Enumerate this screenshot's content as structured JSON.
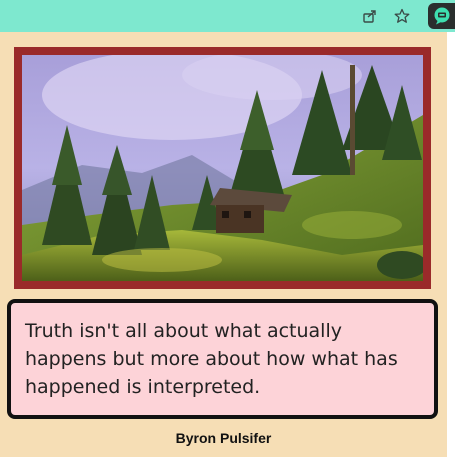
{
  "quote": {
    "text": "Truth isn't all about what actually happens but more about how what has happened is interpreted.",
    "author": "Byron Pulsifer"
  },
  "browser": {
    "icons": [
      "share-icon",
      "star-icon",
      "extension-icon"
    ]
  },
  "colors": {
    "page_background": "#f6deb5",
    "frame": "#9a2a2a",
    "quote_background": "#fdd3d8",
    "chrome": "#7ee8cf"
  }
}
